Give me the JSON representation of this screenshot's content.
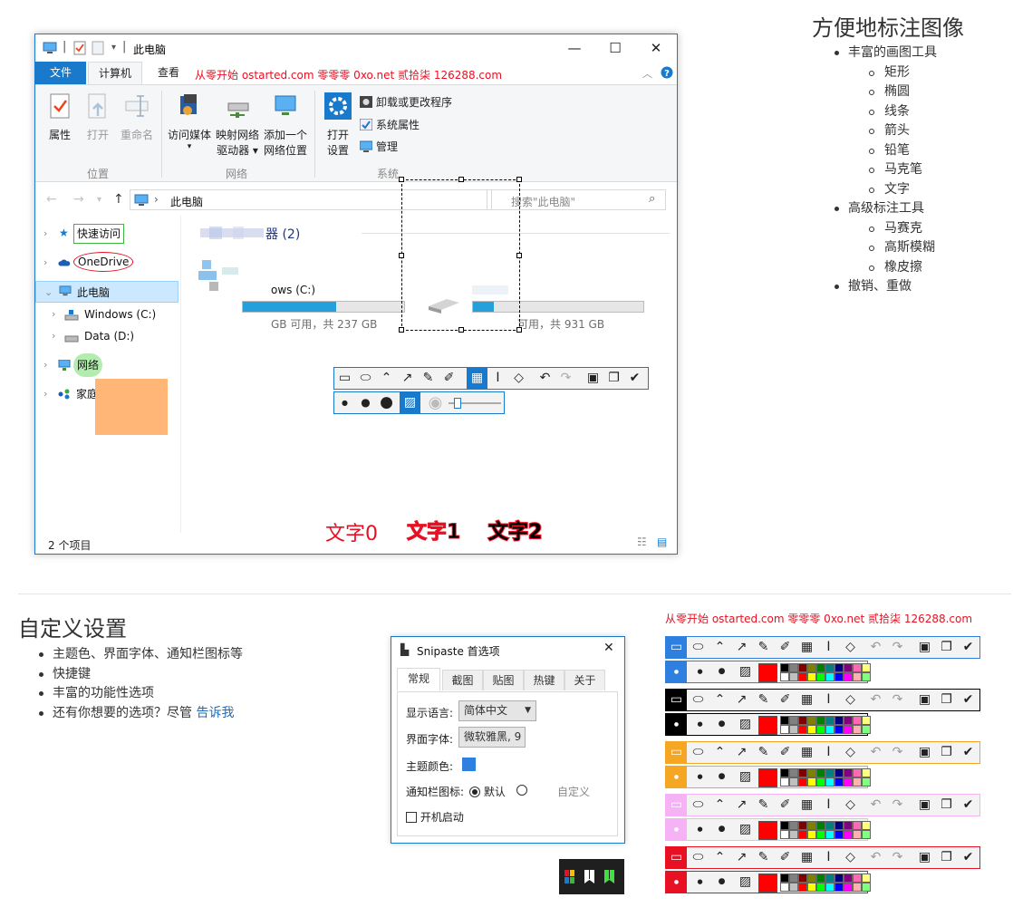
{
  "explorer": {
    "title": "此电脑",
    "tabs": [
      "文件",
      "计算机",
      "查看"
    ],
    "ad_text": "从零开始 ostarted.com 零零零 0xo.net 贰拾柒 126288.com",
    "ribbon": {
      "location_group": "位置",
      "network_group": "网络",
      "system_group": "系统",
      "properties": "属性",
      "open": "打开",
      "rename": "重命名",
      "access_media_1": "访问媒体",
      "map_drive_1": "映射网络",
      "map_drive_2": "驱动器 ▾",
      "add_location_1": "添加一个",
      "add_location_2": "网络位置",
      "open_settings_1": "打开",
      "open_settings_2": "设置",
      "uninstall": "卸载或更改程序",
      "system_props": "系统属性",
      "manage": "管理"
    },
    "address": "此电脑",
    "search_placeholder": "搜索\"此电脑\"",
    "nav": {
      "quick_access": "快速访问",
      "onedrive": "OneDrive",
      "this_pc": "此电脑",
      "windows_c": "Windows (C:)",
      "data_d": "Data (D:)",
      "network": "网络",
      "homegroup": "家庭组"
    },
    "content": {
      "group_heading": "器 (2)",
      "drive_c_name": "ows (C:)",
      "drive_c_space": "GB 可用，共 237 GB",
      "drive_d_space": "可用，共 931 GB",
      "drive_c_fill": 0.58,
      "drive_d_fill": 0.12
    },
    "status": "2 个项目",
    "annot_text0": "文字0",
    "annot_text1": "文字1",
    "annot_text2": "文字2"
  },
  "features": {
    "title": "方便地标注图像",
    "basic_tools": "丰富的画图工具",
    "basic_items": [
      "矩形",
      "椭圆",
      "线条",
      "箭头",
      "铅笔",
      "马克笔",
      "文字"
    ],
    "advanced_tools": "高级标注工具",
    "advanced_items": [
      "马赛克",
      "高斯模糊",
      "橡皮擦"
    ],
    "undo_redo": "撤销、重做"
  },
  "settings": {
    "title": "自定义设置",
    "items": [
      "主题色、界面字体、通知栏图标等",
      "快捷键",
      "丰富的功能性选项"
    ],
    "last_prefix": "还有你想要的选项？尽管 ",
    "last_link": "告诉我"
  },
  "prefs": {
    "title": "Snipaste 首选项",
    "tabs": [
      "常规",
      "截图",
      "贴图",
      "热键",
      "关于"
    ],
    "lang_label": "显示语言:",
    "lang_value": "简体中文",
    "font_label": "界面字体:",
    "font_value": "微软雅黑, 9",
    "theme_label": "主题颜色:",
    "theme_color": "#2d7fe0",
    "tray_label": "通知栏图标:",
    "tray_default": "默认",
    "tray_custom": "自定义",
    "startup": "开机启动"
  },
  "theme_ad": "从零开始 ostarted.com 零零零 0xo.net 贰拾柒 126288.com",
  "theme_colors": [
    "#2d7fe0",
    "#000000",
    "#f5a623",
    "#f5b3f5",
    "#e81123"
  ],
  "palette": [
    "#000000",
    "#808080",
    "#800000",
    "#808000",
    "#008000",
    "#008080",
    "#000080",
    "#800080",
    "#ff69b4",
    "#ffff80",
    "#ffffff",
    "#c0c0c0",
    "#ff0000",
    "#ffff00",
    "#00ff00",
    "#00ffff",
    "#0000ff",
    "#ff00ff",
    "#ffb0b0",
    "#80ff80"
  ],
  "accent": "#1979ca"
}
